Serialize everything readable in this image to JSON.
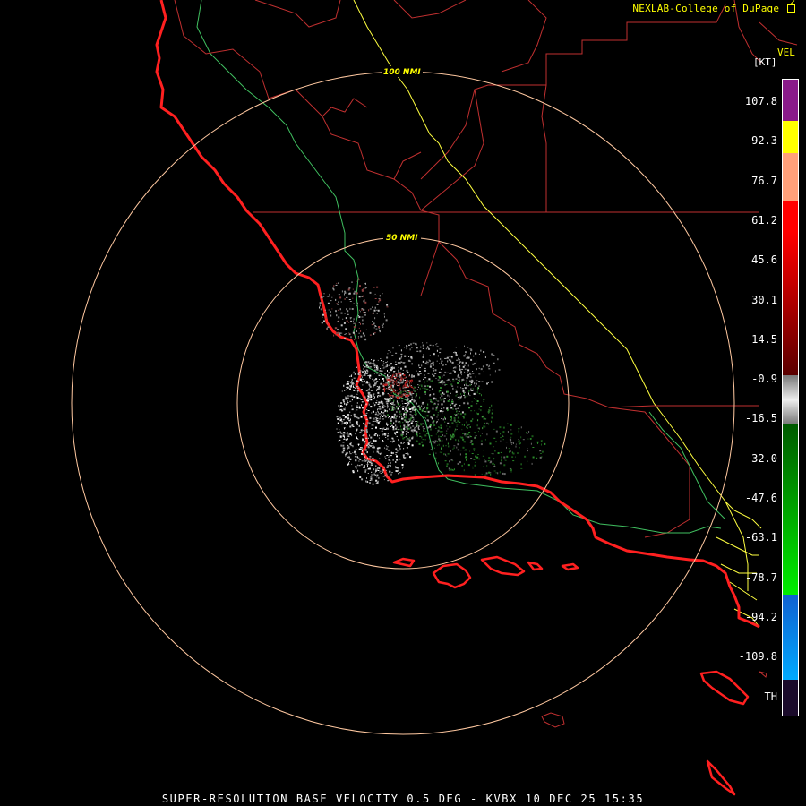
{
  "header": {
    "credit": "NEXLAB-College of DuPage",
    "credit_icon": "external-link-icon"
  },
  "legend": {
    "title": "VEL",
    "unit": "[KT]",
    "ticks": [
      "107.8",
      "92.3",
      "76.7",
      "61.2",
      "45.6",
      "30.1",
      "14.5",
      "-0.9",
      "-16.5",
      "-32.0",
      "-47.6",
      "-63.1",
      "-78.7",
      "-94.2",
      "-109.8",
      "TH"
    ],
    "colors": {
      "purple": "#8a1a8a",
      "yellow": "#ffff00",
      "salmon": "#ffa07a",
      "red": "#ff0000",
      "dark_red": "#5a0000",
      "gray": "#aaaaaa",
      "green": "#00ee00",
      "dark_green": "#005a00",
      "blue": "#1060d0",
      "cyan": "#00aaff",
      "range_fold": "#1a0a2a"
    }
  },
  "map": {
    "radar_site": "KVBX",
    "range_rings": [
      {
        "label": "50 NMI",
        "nmi": 50
      },
      {
        "label": "100 NMI",
        "nmi": 100
      }
    ],
    "colors": {
      "coastline": "#ff2020",
      "county_lines": "#c03030",
      "highways": "#ffff40",
      "rivers": "#40c060",
      "range_rings": "#ffc8a0"
    }
  },
  "footer": {
    "product_line": "SUPER-RESOLUTION BASE VELOCITY 0.5 DEG - KVBX 10 DEC 25 15:35"
  }
}
